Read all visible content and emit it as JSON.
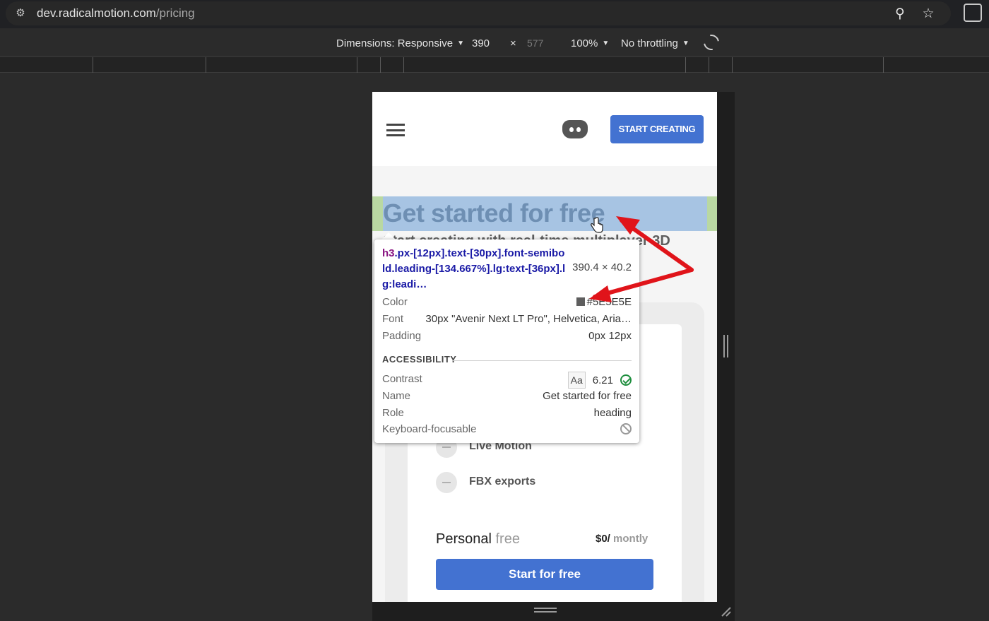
{
  "browser": {
    "url_host": "dev.radicalmotion.com",
    "url_path": "/pricing",
    "site_info_icon": "tune-icon",
    "zoom_icon": "magnifier-icon",
    "bookmark_icon": "star-icon",
    "extensions_icon": "puzzle-icon"
  },
  "device_toolbar": {
    "dimensions_label": "Dimensions: Responsive",
    "width": "390",
    "times": "×",
    "height": "577",
    "zoom": "100%",
    "throttling": "No throttling",
    "rotate_icon": "rotate-icon"
  },
  "page": {
    "nav": {
      "menu_icon": "hamburger-icon",
      "discord_icon": "discord-icon",
      "start_button": "START CREATING"
    },
    "hero": {
      "title": "Get started for free",
      "subtitle": "Start creating with real-time multiplayer 3D"
    },
    "features": [
      {
        "label": "Live Motion"
      },
      {
        "label": "FBX exports"
      }
    ],
    "plan": {
      "name": "Personal",
      "name_suffix": "free",
      "price": "$0/",
      "price_unit": "montly",
      "button": "Start for free"
    }
  },
  "inspect_tooltip": {
    "tag": "h3",
    "selector": ".px-[12px].text-[30px].font-semibold.leading-[134.667%].lg:text-[36px].lg:leadi…",
    "size": "390.4 × 40.2",
    "color_label": "Color",
    "color_value": "#5E5E5E",
    "font_label": "Font",
    "font_value": "30px \"Avenir Next LT Pro\", Helvetica, Aria…",
    "padding_label": "Padding",
    "padding_value": "0px 12px",
    "accessibility_header": "ACCESSIBILITY",
    "contrast_label": "Contrast",
    "contrast_aa": "Aa",
    "contrast_value": "6.21",
    "name_label": "Name",
    "name_value": "Get started for free",
    "role_label": "Role",
    "role_value": "heading",
    "keyboard_label": "Keyboard-focusable"
  },
  "colors": {
    "accent_blue": "#4372d1",
    "annotation_red": "#e0141a",
    "heading_color": "#5E5E5E"
  }
}
